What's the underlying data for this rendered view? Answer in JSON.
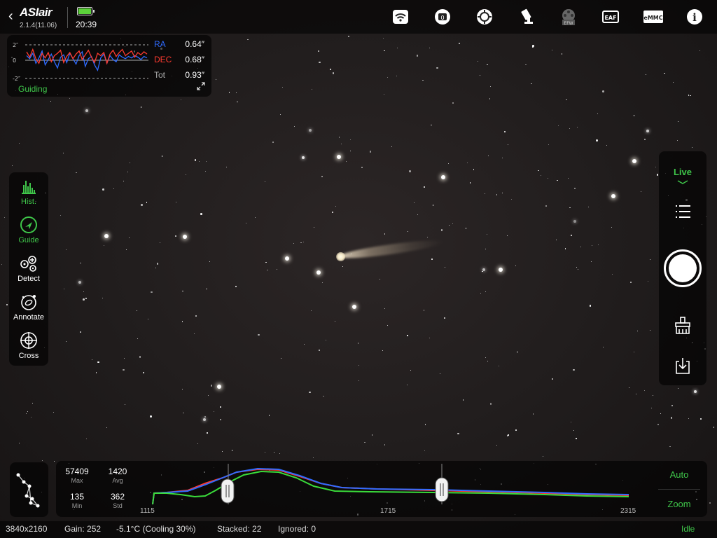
{
  "app": {
    "back_icon": "chevron-left-icon",
    "logo": "ASIair",
    "version": "2.1.4(11.06)",
    "time": "20:39",
    "battery_color": "#5cd13a"
  },
  "top_icons": [
    {
      "name": "wifi-icon"
    },
    {
      "name": "camera-icon"
    },
    {
      "name": "guide-camera-icon"
    },
    {
      "name": "telescope-mount-icon"
    },
    {
      "name": "efw-icon",
      "label": "EFW"
    },
    {
      "name": "eaf-icon",
      "label": "EAF"
    },
    {
      "name": "emmc-icon",
      "label": "eMMC"
    },
    {
      "name": "info-icon",
      "label": "i"
    }
  ],
  "guiding": {
    "axis_labels": [
      "2″",
      "0",
      "-2″"
    ],
    "ra_label": "RA",
    "ra_value": "0.64″",
    "dec_label": "DEC",
    "dec_value": "0.68″",
    "tot_label": "Tot",
    "tot_value": "0.93″",
    "status": "Guiding",
    "ra_color": "#2f6bff",
    "dec_color": "#ff3b30",
    "ra_series": [
      0.6,
      0.2,
      0.9,
      -0.4,
      0.3,
      1.2,
      -0.6,
      0.1,
      0.8,
      -0.2,
      -1.0,
      0.4,
      0.7,
      -0.3,
      0.9,
      0.2,
      -0.5,
      0.6,
      1.1,
      -0.8,
      0.2,
      0.5,
      -0.6,
      -1.3,
      0.3,
      0.8,
      -0.4,
      0.6,
      0.1,
      -0.2,
      0.7,
      0.4,
      0.2,
      0.5,
      0.3,
      0.6,
      0.4,
      0.1,
      0.5,
      0.3
    ],
    "dec_series": [
      1.1,
      0.4,
      1.4,
      0.2,
      -0.4,
      0.9,
      0.3,
      1.0,
      -0.2,
      0.6,
      0.9,
      1.3,
      -0.3,
      0.5,
      1.0,
      0.2,
      0.8,
      1.2,
      0.1,
      0.7,
      1.3,
      0.4,
      -0.3,
      0.9,
      0.6,
      1.0,
      -0.4,
      0.8,
      1.3,
      0.5,
      1.0,
      1.4,
      0.6,
      0.9,
      1.2,
      0.4,
      1.0,
      0.7,
      1.1,
      0.8
    ]
  },
  "left_toolbar": [
    {
      "name": "hist",
      "label": "Hist.",
      "active": true
    },
    {
      "name": "guide",
      "label": "Guide",
      "active": true
    },
    {
      "name": "detect",
      "label": "Detect",
      "active": false
    },
    {
      "name": "annotate",
      "label": "Annotate",
      "active": false
    },
    {
      "name": "cross",
      "label": "Cross",
      "active": false
    }
  ],
  "right_toolbar": {
    "mode_label": "Live",
    "icons": [
      "list-icon",
      "shutter-button",
      "clean-brush-icon",
      "download-icon"
    ]
  },
  "histogram": {
    "max_value": "57409",
    "max_label": "Max",
    "avg_value": "1420",
    "avg_label": "Avg",
    "min_value": "135",
    "min_label": "Min",
    "std_value": "362",
    "std_label": "Std",
    "ticks": [
      "1115",
      "1715",
      "2315"
    ],
    "auto_label": "Auto",
    "zoom_label": "Zoom",
    "black_point": 1290,
    "white_point": 1800
  },
  "status_bar": {
    "resolution": "3840x2160",
    "gain": "Gain: 252",
    "temperature": "-5.1°C (Cooling 30%)",
    "stacked": "Stacked: 22",
    "ignored": "Ignored: 0",
    "state": "Idle"
  }
}
